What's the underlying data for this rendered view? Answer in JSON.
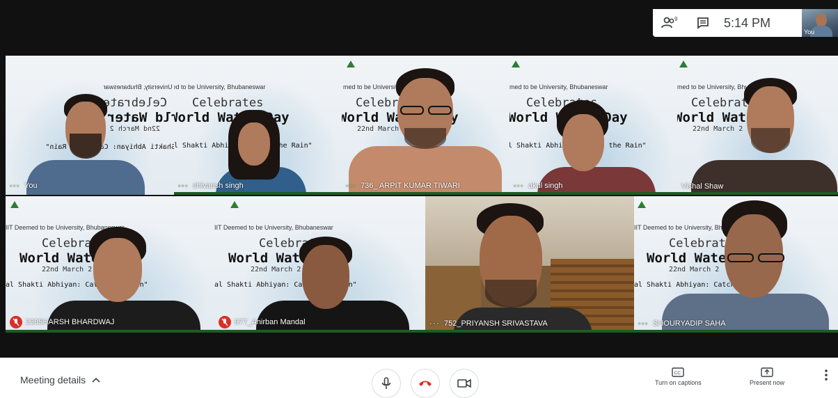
{
  "topbar": {
    "people_icon": "people-icon",
    "people_count": "9",
    "chat_icon": "chat-icon",
    "time": "5:14 PM",
    "self_label": "You"
  },
  "banner": {
    "institution": "med to be University, Bhubaneswar",
    "institution_full": "IIT Deemed to be University, Bhubaneswar",
    "celebrates": "Celebrates",
    "celebrate_short": "Celebrat",
    "world_water_day": "World Water Day",
    "date": "22nd March 2",
    "abhiyan": "al Shakti Abhiyan: Catch the Rain\"",
    "catch_rain": "CatchTheRain"
  },
  "participants": [
    {
      "name": "You",
      "muted": false
    },
    {
      "name": "shivansh singh",
      "muted": false
    },
    {
      "name": "736_ ARPIT KUMAR TIWARI",
      "muted": false
    },
    {
      "name": "akul singh",
      "muted": false
    },
    {
      "name": "Vishal Shaw",
      "muted": false
    },
    {
      "name": "2305HARSH BHARDWAJ",
      "muted": true
    },
    {
      "name": "977_Anirban Mandal",
      "muted": true
    },
    {
      "name": "752_PRIYANSH SRIVASTAVA",
      "muted": false
    },
    {
      "name": "SHOURYADIP SAHA",
      "muted": false
    }
  ],
  "bottombar": {
    "meeting_details": "Meeting details",
    "captions_label": "Turn on captions",
    "present_label": "Present now",
    "leave_color": "#d93025"
  }
}
